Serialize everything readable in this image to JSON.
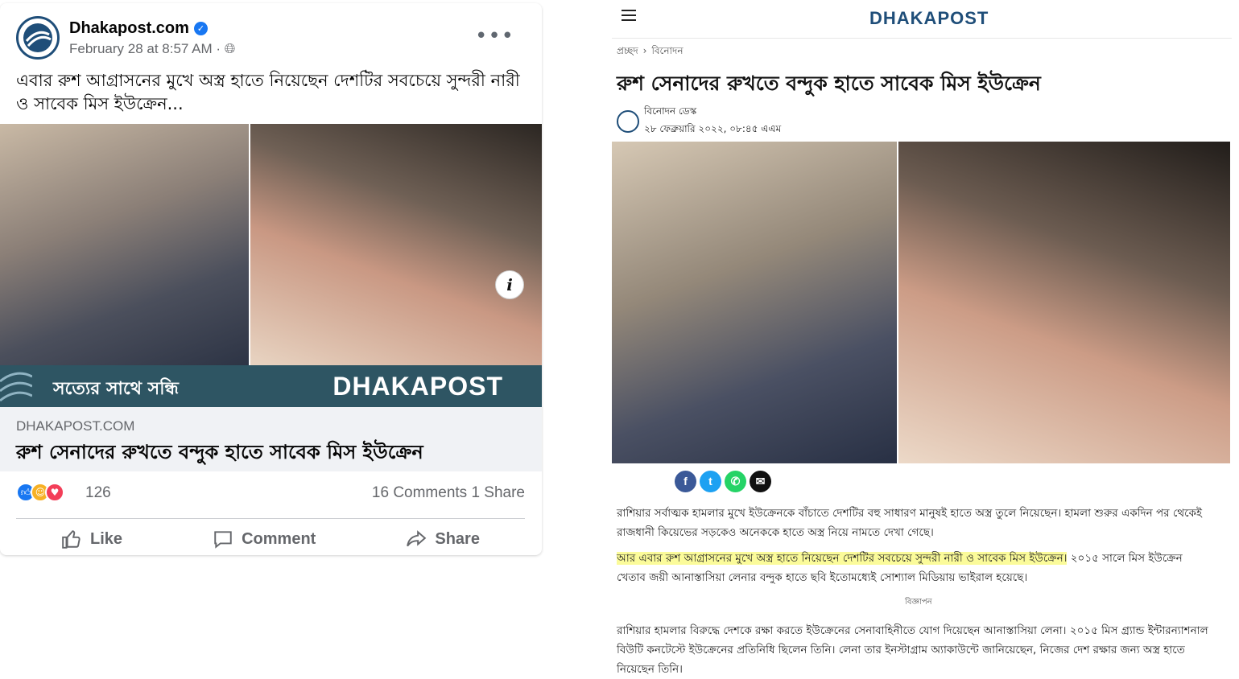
{
  "facebook_post": {
    "page_name": "Dhakapost.com",
    "timestamp": "February 28 at 8:57 AM ·",
    "caption": "এবার রুশ আগ্রাসনের মুখে অস্ত্র হাতে নিয়েছেন দেশটির সবচেয়ে সুন্দরী নারী ও সাবেক মিস ইউক্রেন...",
    "banner_slogan": "সত্যের সাথে সন্ধি",
    "banner_logo": "DHAKAPOST",
    "link_domain": "DHAKAPOST.COM",
    "link_title": "রুশ সেনাদের রুখতে বন্দুক হাতে সাবেক মিস ইউক্রেন",
    "reaction_count": "126",
    "comments_shares": "16 Comments  1 Share",
    "actions": {
      "like": "Like",
      "comment": "Comment",
      "share": "Share"
    }
  },
  "article": {
    "logo": "DHAKAPOST",
    "breadcrumb": {
      "home": "প্রচ্ছদ",
      "section": "বিনোদন"
    },
    "title": "রুশ সেনাদের রুখতে বন্দুক হাতে সাবেক মিস ইউক্রেন",
    "author": "বিনোদন ডেস্ক",
    "date": "২৮ ফেব্রুয়ারি ২০২২, ০৮:৪৫ এএম",
    "paragraph1": "রাশিয়ার সর্বাত্মক হামলার মুখে ইউক্রেনকে বাঁচাতে দেশটির বহু সাধারণ মানুষই হাতে অস্ত্র তুলে নিয়েছেন। হামলা শুরুর একদিন পর থেকেই রাজধানী কিয়েভের সড়কেও অনেককে হাতে অস্ত্র নিয়ে নামতে দেখা গেছে।",
    "paragraph2_highlight": "আর এবার রুশ আগ্রাসনের মুখে অস্ত্র হাতে নিয়েছেন দেশটির সবচেয়ে সুন্দরী নারী ও সাবেক মিস ইউক্রেন।",
    "paragraph2_rest": " ২০১৫ সালে মিস ইউক্রেন খেতাব জয়ী আনাস্তাসিয়া লেনার বন্দুক হাতে ছবি ইতোমধ্যেই সোশ্যাল মিডিয়ায় ভাইরাল হয়েছে।",
    "ad_label": "বিজ্ঞাপন",
    "paragraph3": "রাশিয়ার হামলার বিরুদ্ধে দেশকে রক্ষা করতে ইউক্রেনের সেনাবাহিনীতে যোগ দিয়েছেন আনাস্তাসিয়া লেনা। ২০১৫ মিস গ্র্যান্ড ইন্টারন্যাশনাল বিউটি কনটেস্টে ইউক্রেনের প্রতিনিধি ছিলেন তিনি। লেনা তার ইনস্টাগ্রাম অ্যাকাউন্টে জানিয়েছেন, নিজের দেশ রক্ষার জন্য অস্ত্র হাতে নিয়েছেন তিনি।"
  },
  "colors": {
    "fb_blue": "#1877f2",
    "banner_teal": "#2e5563",
    "dp_navy": "#1f4e79",
    "highlight_yellow": "#fbfb9a"
  }
}
